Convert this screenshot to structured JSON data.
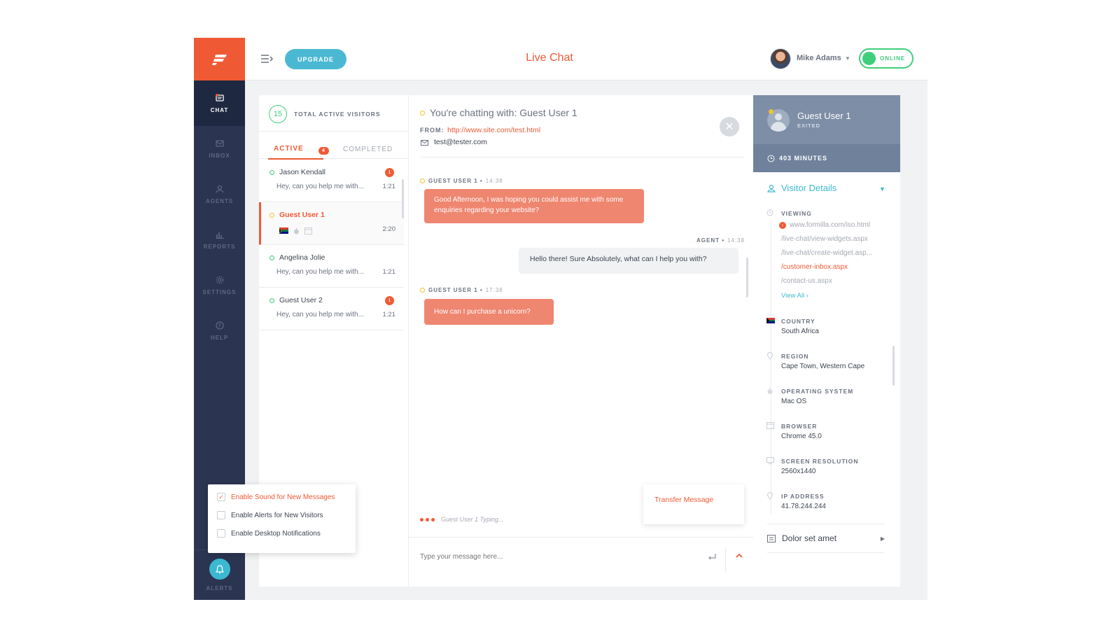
{
  "topbar": {
    "upgrade_label": "UPGRADE",
    "title": "Live Chat",
    "user_name": "Mike Adams",
    "status_label": "ONLINE"
  },
  "sidebar": {
    "items": [
      {
        "label": "CHAT",
        "icon": "chat-icon",
        "active": true
      },
      {
        "label": "INBOX",
        "icon": "inbox-icon",
        "active": false
      },
      {
        "label": "AGENTS",
        "icon": "agents-icon",
        "active": false
      },
      {
        "label": "REPORTS",
        "icon": "reports-icon",
        "active": false
      },
      {
        "label": "SETTINGS",
        "icon": "gear-icon",
        "active": false
      },
      {
        "label": "HELP",
        "icon": "help-icon",
        "active": false
      }
    ],
    "alerts_label": "ALERTS"
  },
  "visitors": {
    "count": "15",
    "count_label": "TOTAL ACTIVE VISITORS",
    "tab_active": "ACTIVE",
    "tab_active_badge": "4",
    "tab_completed": "COMPLETED",
    "rows": [
      {
        "name": "Jason Kendall",
        "message": "Hey, can you help me with...",
        "time": "1:21",
        "badge": "1"
      },
      {
        "name": "Guest User 1",
        "time": "2:20"
      },
      {
        "name": "Angelina Jolie",
        "message": "Hey, can you help me with...",
        "time": "1:21"
      },
      {
        "name": "Guest User 2",
        "message": "Hey, can you help me with...",
        "time": "1:21",
        "badge": "1"
      }
    ]
  },
  "chat": {
    "header": "You're chatting with: Guest User 1",
    "from_label": "FROM:",
    "from_url": "http://www.site.com/test.html",
    "email": "test@tester.com",
    "messages": [
      {
        "sender": "GUEST USER 1",
        "time": "14:38",
        "text": "Good Afternoon, I was hoping you could assist me with some enquiries regarding your website?"
      },
      {
        "sender": "AGENT",
        "time": "14:38",
        "text": "Hello there! Sure Absolutely, what can I help you with?"
      },
      {
        "sender": "GUEST USER 1",
        "time": "17:38",
        "text": "How can I purchase a unicorn?"
      }
    ],
    "typing": "Guest User 1 Typing...",
    "transfer_label": "Transfer Message",
    "input_placeholder": "Type your message here..."
  },
  "details": {
    "guest_name": "Guest User 1",
    "guest_status": "EXITED",
    "minutes": "403 MINUTES",
    "section_title": "Visitor Details",
    "viewing_label": "VIEWING",
    "pages": [
      "www.formilla.com/iso.html",
      "/live-chat/view-widgets.aspx",
      "/live-chat/create-widget.asp...",
      "/customer-inbox.aspx",
      "/contact-us.aspx"
    ],
    "view_all": "View All",
    "country_label": "COUNTRY",
    "country": "South Africa",
    "region_label": "REGION",
    "region": "Cape Town, Western Cape",
    "os_label": "OPERATING SYSTEM",
    "os": "Mac OS",
    "browser_label": "BROWSER",
    "browser": "Chrome 45.0",
    "resolution_label": "SCREEN RESOLUTION",
    "resolution": "2560x1440",
    "ip_label": "IP ADDRESS",
    "ip": "41.78.244.244",
    "extra_section": "Dolor set amet"
  },
  "popup": {
    "options": [
      {
        "label": "Enable Sound for New Messages",
        "checked": true
      },
      {
        "label": "Enable Alerts for New Visitors",
        "checked": false
      },
      {
        "label": "Enable Desktop Notifications",
        "checked": false
      }
    ]
  },
  "colors": {
    "brand": "#ef5a35",
    "sidebar": "#2b3551",
    "accent": "#4ab8d3",
    "online": "#3fcf7a",
    "guest_bubble": "#ef8670"
  }
}
